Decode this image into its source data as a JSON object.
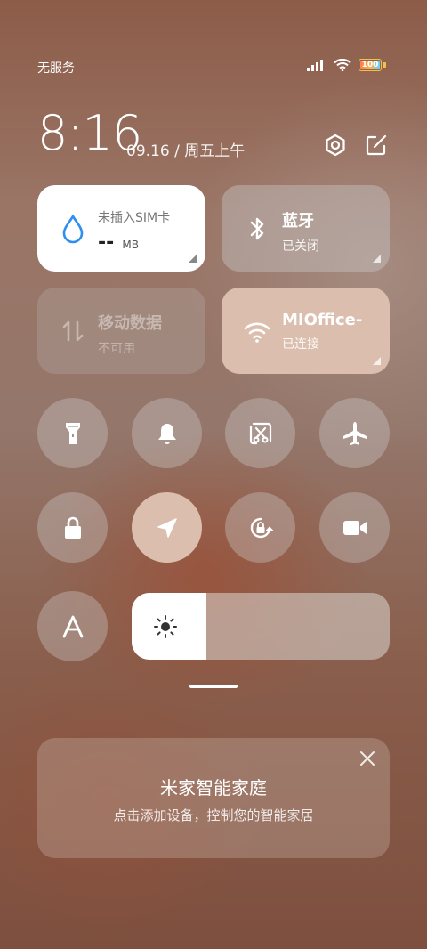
{
  "status_bar": {
    "carrier": "无服务",
    "battery": "100",
    "icons": [
      "signal-icon",
      "wifi-icon",
      "battery-icon"
    ]
  },
  "header": {
    "time": "8:16",
    "date": "09.16 / 周五上午",
    "icons": [
      "settings-icon",
      "edit-icon"
    ]
  },
  "tiles": {
    "data_usage": {
      "title": "未插入SIM卡",
      "value": "--",
      "unit": "MB",
      "icon": "water-drop-icon"
    },
    "bluetooth": {
      "title": "蓝牙",
      "status": "已关闭",
      "icon": "bluetooth-icon"
    },
    "mobile_data": {
      "title": "移动数据",
      "status": "不可用",
      "icon": "mobile-data-icon"
    },
    "wifi": {
      "title": "MIOffice-",
      "status": "已连接",
      "icon": "wifi-icon"
    }
  },
  "toggles": [
    {
      "name": "flashlight",
      "icon": "flashlight-icon",
      "active": false
    },
    {
      "name": "ring",
      "icon": "bell-icon",
      "active": false
    },
    {
      "name": "screenshot",
      "icon": "scissors-icon",
      "active": false
    },
    {
      "name": "airplane",
      "icon": "airplane-icon",
      "active": false
    },
    {
      "name": "lock",
      "icon": "lock-icon",
      "active": false
    },
    {
      "name": "location",
      "icon": "location-arrow-icon",
      "active": true
    },
    {
      "name": "rotation-lock",
      "icon": "rotation-lock-icon",
      "active": false
    },
    {
      "name": "screen-record",
      "icon": "video-camera-icon",
      "active": false
    },
    {
      "name": "auto-brightness",
      "icon": "letter-a-icon",
      "active": false
    }
  ],
  "brightness": {
    "level": 0.29,
    "icon": "sun-icon"
  },
  "smart_home": {
    "title": "米家智能家庭",
    "subtitle": "点击添加设备，控制您的智能家居"
  },
  "colors": {
    "accent": "#dbbeae",
    "data_icon": "#2f8ff0"
  }
}
